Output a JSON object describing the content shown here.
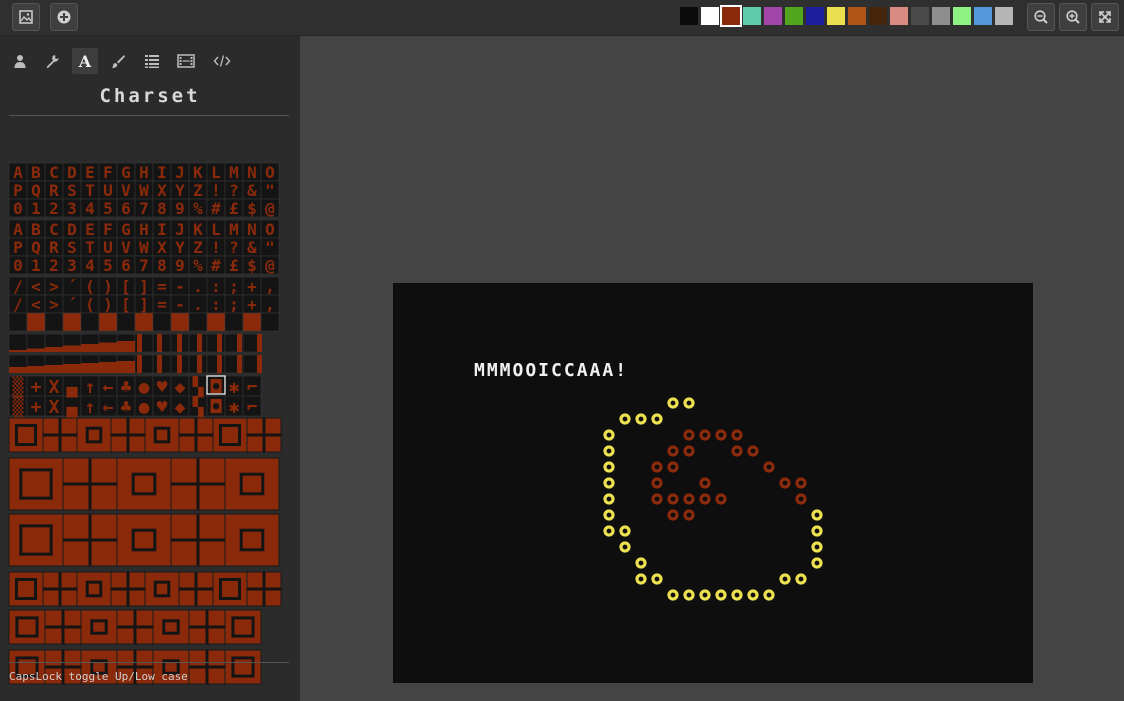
{
  "toolbar": {
    "buttons": [
      {
        "name": "image-button",
        "icon": "image-icon"
      },
      {
        "name": "add-button",
        "icon": "plus-circle-icon"
      }
    ],
    "palette": [
      "#0b0b0b",
      "#ffffff",
      "#8b2a0b",
      "#5fc9a8",
      "#a046a8",
      "#52a61e",
      "#1c1f9c",
      "#ebe04f",
      "#b05516",
      "#46250d",
      "#d98a82",
      "#4a4a4a",
      "#8e8e8e",
      "#8ef283",
      "#5599dd",
      "#b5b5b5"
    ],
    "selected_color_index": 2,
    "view_buttons": [
      {
        "name": "zoom-out-button",
        "icon": "zoom-out-icon"
      },
      {
        "name": "zoom-in-button",
        "icon": "zoom-in-icon"
      },
      {
        "name": "fullscreen-button",
        "icon": "fullscreen-icon"
      }
    ]
  },
  "sidebar": {
    "tabs": [
      {
        "name": "tab-user",
        "icon": "user-icon"
      },
      {
        "name": "tab-tools",
        "icon": "wrench-icon"
      },
      {
        "name": "tab-charset",
        "icon": "letter-a-icon",
        "active": true
      },
      {
        "name": "tab-paint",
        "icon": "brush-icon"
      },
      {
        "name": "tab-list",
        "icon": "list-icon"
      },
      {
        "name": "tab-film",
        "icon": "film-icon"
      },
      {
        "name": "tab-code",
        "icon": "code-icon"
      }
    ],
    "title": "Charset",
    "status": "CapsLock toggle Up/Low case"
  },
  "charset": {
    "text_rows": [
      "ABCDEFGHIJKLMNO",
      "PQRSTUVWXYZ!?&\"",
      "0123456789%#£$@",
      "ABCDEFGHIJKLMNO",
      "PQRSTUVWXYZ!?&\"",
      "0123456789%#£$@"
    ],
    "punct_rows": [
      "/<>´()[]=-.:;+,",
      "/<>´()[]=-.:;+,"
    ],
    "symbol_rows": [
      "▒+X▄↑←♣●♥◆▚◘✱⌐",
      "▒+X▄↑←♣●♥◆▚◘✱⌐"
    ],
    "foreground": "#8b2a0b",
    "background": "#141414"
  },
  "canvas": {
    "background": "#0e0e0e",
    "text": "MMMOOICCAAA!",
    "text_color": "#f0f0f0",
    "yellow": "#ebe04f",
    "red": "#8b2a0b"
  }
}
